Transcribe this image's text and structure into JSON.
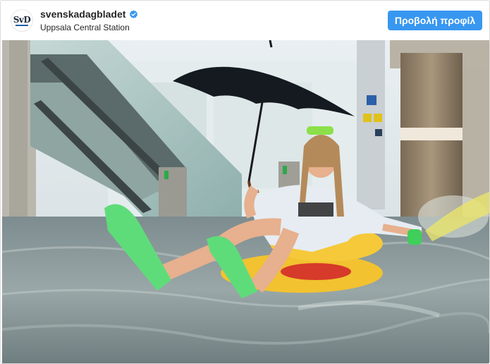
{
  "header": {
    "avatar_logo": "SvD",
    "username": "svenskadagbladet",
    "location": "Uppsala Central Station",
    "view_profile_label": "Προβολή προφίλ"
  },
  "icons": {
    "verified": "verified-badge-icon"
  },
  "colors": {
    "accent": "#3897f0",
    "verified": "#3897f0",
    "border": "#dbdbdb"
  }
}
